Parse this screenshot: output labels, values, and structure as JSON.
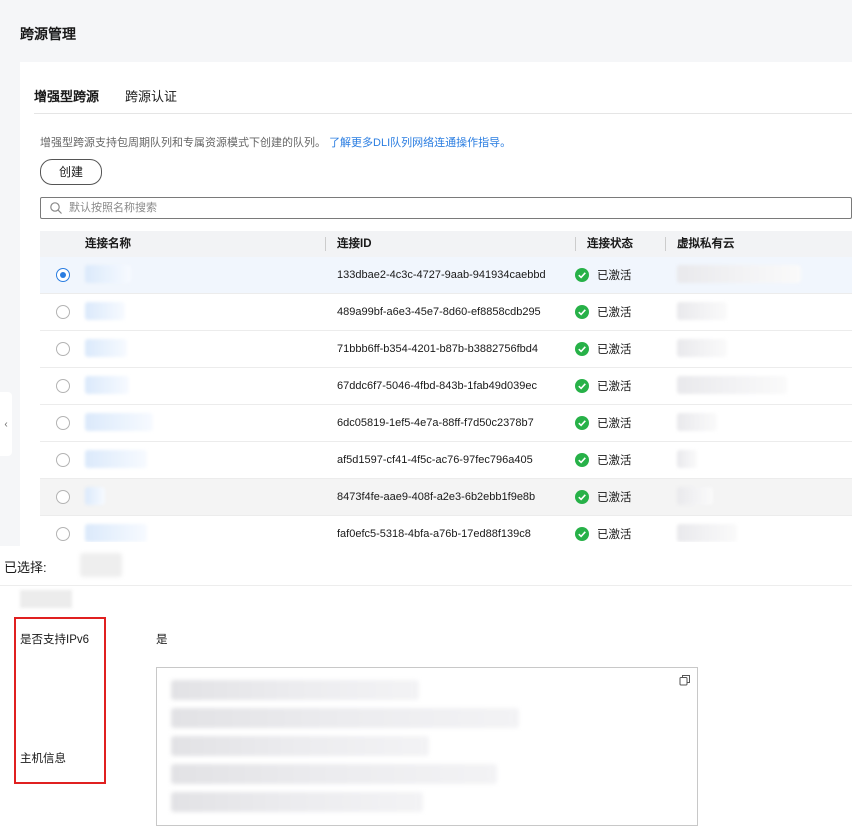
{
  "page": {
    "title": "跨源管理"
  },
  "tabs": [
    {
      "label": "增强型跨源",
      "active": true
    },
    {
      "label": "跨源认证",
      "active": false
    }
  ],
  "description": {
    "text": "增强型跨源支持包周期队列和专属资源模式下创建的队列。",
    "link": "了解更多DLI队列网络连通操作指导。"
  },
  "toolbar": {
    "create_label": "创建"
  },
  "search": {
    "placeholder": "默认按照名称搜索"
  },
  "table": {
    "columns": [
      "连接名称",
      "连接ID",
      "连接状态",
      "虚拟私有云"
    ],
    "rows": [
      {
        "id": "133dbae2-4c3c-4727-9aab-941934caebbd",
        "status": "已激活",
        "selected": true
      },
      {
        "id": "489a99bf-a6e3-45e7-8d60-ef8858cdb295",
        "status": "已激活",
        "selected": false
      },
      {
        "id": "71bbb6ff-b354-4201-b87b-b3882756fbd4",
        "status": "已激活",
        "selected": false
      },
      {
        "id": "67ddc6f7-5046-4fbd-843b-1fab49d039ec",
        "status": "已激活",
        "selected": false
      },
      {
        "id": "6dc05819-1ef5-4e7a-88ff-f7d50c2378b7",
        "status": "已激活",
        "selected": false
      },
      {
        "id": "af5d1597-cf41-4f5c-ac76-97fec796a405",
        "status": "已激活",
        "selected": false
      },
      {
        "id": "8473f4fe-aae9-408f-a2e3-6b2ebb1f9e8b",
        "status": "已激活",
        "selected": false
      },
      {
        "id": "faf0efc5-5318-4bfa-a76b-17ed88f139c8",
        "status": "已激活",
        "selected": false
      }
    ]
  },
  "detail": {
    "selected_label": "已选择:",
    "ipv6_label": "是否支持IPv6",
    "ipv6_value": "是",
    "host_label": "主机信息"
  },
  "colors": {
    "accent": "#2a7de1",
    "success": "#27b148",
    "highlight": "#e02020"
  },
  "icons": {
    "search": "search-icon",
    "status": "check-circle-icon",
    "copy": "copy-icon",
    "collapse": "chevron-left-icon"
  }
}
